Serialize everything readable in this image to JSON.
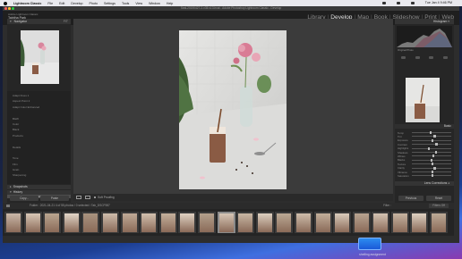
{
  "menubar": {
    "items": [
      "Lightroom Classic",
      "File",
      "Edit",
      "Develop",
      "Photo",
      "Settings",
      "Tools",
      "View",
      "Window",
      "Help"
    ],
    "clock": "Tue Jan 4 9:46 PM"
  },
  "window": {
    "title": "Seal-20190427-2-v35-v13.lrcat - Adobe Photoshop Lightroom Classic - Develop"
  },
  "identity": {
    "line1": "Adobe Lightroom Classic",
    "line2": "Tabitha Park"
  },
  "modules": [
    {
      "label": "Library",
      "active": false
    },
    {
      "label": "Develop",
      "active": true
    },
    {
      "label": "Map",
      "active": false
    },
    {
      "label": "Book",
      "active": false
    },
    {
      "label": "Slideshow",
      "active": false
    },
    {
      "label": "Print",
      "active": false
    },
    {
      "label": "Web",
      "active": false
    }
  ],
  "left_panel": {
    "navigator_label": "Navigator",
    "navigator_zoom": "FIT",
    "presets": [
      "Adapt Fixes 1",
      "Aspect Point 2",
      "Adapt Color Enhanced",
      "",
      "B&W",
      "Color",
      "Black",
      "Products",
      "",
      "Details",
      "",
      "Tone",
      "Film",
      "Grain",
      "Sharpening",
      "Vignetting"
    ],
    "selected_preset": "Sepia - Hard Shoe 1/25/21 12.0 P.M.",
    "snapshots_label": "Snapshots",
    "history_label": "History",
    "history_item": "Batch Edit",
    "copy_label": "Copy...",
    "paste_label": "Paste"
  },
  "toolbar": {
    "soft_proofing": "Soft Proofing"
  },
  "right_panel": {
    "histogram_label": "Histogram",
    "original_photo": "Original Photo",
    "basic_label": "Basic",
    "sliders": [
      {
        "label": "Temp",
        "pos": 0.45
      },
      {
        "label": "Tint",
        "pos": 0.55
      },
      {
        "label": "Exposure",
        "pos": 0.5
      },
      {
        "label": "Contrast",
        "pos": 0.6
      },
      {
        "label": "Highlights",
        "pos": 0.4
      },
      {
        "label": "Shadows",
        "pos": 0.58
      },
      {
        "label": "Whites",
        "pos": 0.52
      },
      {
        "label": "Blacks",
        "pos": 0.47
      },
      {
        "label": "Texture",
        "pos": 0.5
      },
      {
        "label": "Clarity",
        "pos": 0.55
      },
      {
        "label": "Vibrance",
        "pos": 0.5
      },
      {
        "label": "Saturation",
        "pos": 0.5
      }
    ],
    "lens_label": "Lens Corrections",
    "previous_label": "Previous",
    "reset_label": "Reset"
  },
  "filmstrip": {
    "info": "Folder : 2021-04-21     4 of 55 photos / 0 selected / Tab_DSCF987",
    "filter_label": "Filter :",
    "filter_value": "Filters Off"
  },
  "dock": {
    "label": "shelling assignment"
  },
  "colors": {
    "accent": "#e6e6e6",
    "panel": "#262626",
    "background": "#3b3b3b"
  }
}
